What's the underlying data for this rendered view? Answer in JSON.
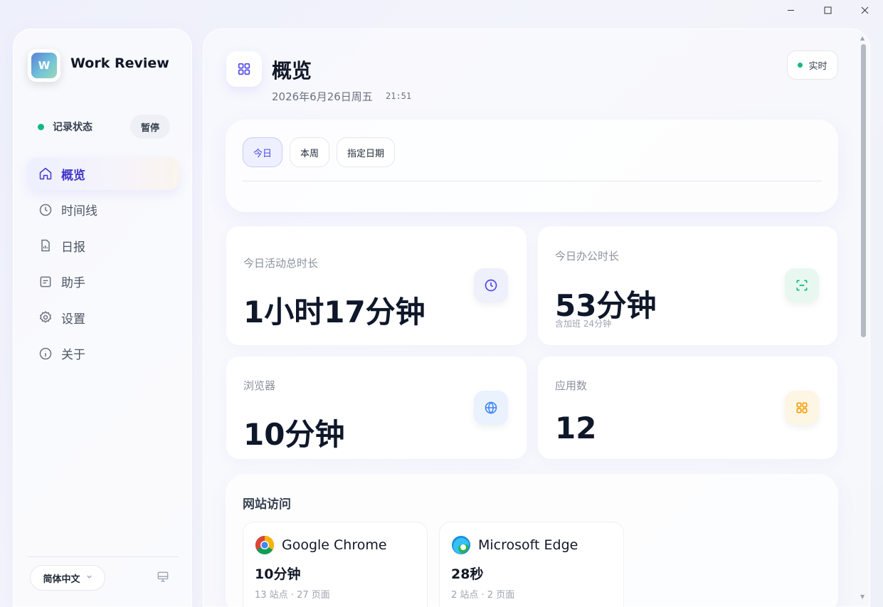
{
  "window": {
    "minimize": "—",
    "maximize": "☐",
    "close": "✕"
  },
  "app": {
    "title": "Work Review",
    "logo_glyph": "W"
  },
  "recording": {
    "label": "记录状态",
    "pause_label": "暂停",
    "status_color": "#10b981"
  },
  "nav": [
    {
      "label": "概览",
      "icon": "home-icon",
      "active": true
    },
    {
      "label": "时间线",
      "icon": "clock-icon",
      "active": false
    },
    {
      "label": "日报",
      "icon": "report-icon",
      "active": false
    },
    {
      "label": "助手",
      "icon": "assistant-icon",
      "active": false
    },
    {
      "label": "设置",
      "icon": "gear-icon",
      "active": false
    },
    {
      "label": "关于",
      "icon": "info-icon",
      "active": false
    }
  ],
  "language": {
    "label": "简体中文"
  },
  "header": {
    "title": "概览",
    "date": "2026年6月26日周五",
    "time": "21:51",
    "live_label": "实时"
  },
  "range_tabs": [
    {
      "label": "今日",
      "active": true
    },
    {
      "label": "本周",
      "active": false
    },
    {
      "label": "指定日期",
      "active": false
    }
  ],
  "stats": {
    "active_total": {
      "label": "今日活动总时长",
      "value": "1小时17分钟",
      "icon": "clock-icon",
      "accent": "#4f46e5"
    },
    "office": {
      "label": "今日办公时长",
      "value": "53分钟",
      "sub": "含加班 24分钟",
      "icon": "focus-icon",
      "accent": "#10b981"
    },
    "browser": {
      "label": "浏览器",
      "value": "10分钟",
      "icon": "globe-icon",
      "accent": "#3b82f6"
    },
    "apps": {
      "label": "应用数",
      "value": "12",
      "icon": "grid-icon",
      "accent": "#f59e0b"
    }
  },
  "sites": {
    "title": "网站访问",
    "items": [
      {
        "browser": "Google Chrome",
        "icon": "chrome-icon",
        "time": "10分钟",
        "meta": "13 站点 · 27 页面"
      },
      {
        "browser": "Microsoft Edge",
        "icon": "edge-icon",
        "time": "28秒",
        "meta": "2 站点 · 2 页面"
      }
    ]
  }
}
